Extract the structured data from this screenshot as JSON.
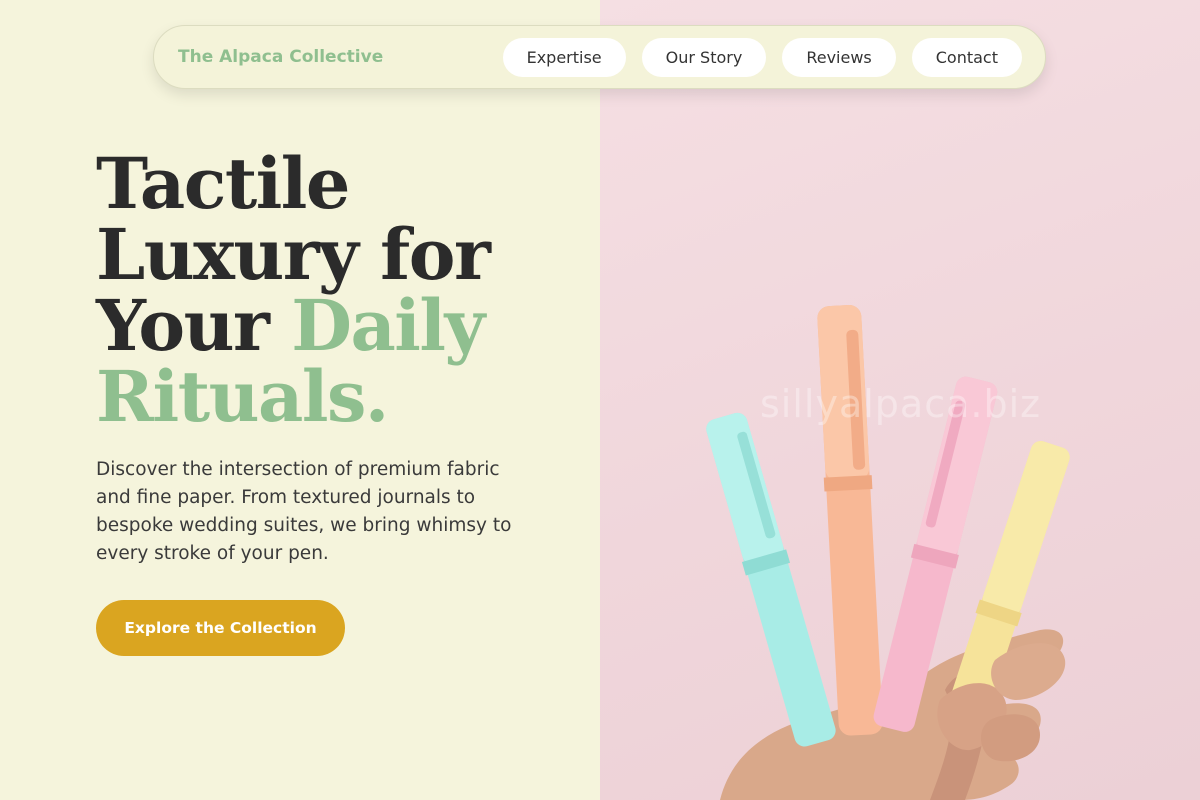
{
  "nav": {
    "brand": "The Alpaca Collective",
    "links": [
      {
        "label": "Expertise"
      },
      {
        "label": "Our Story"
      },
      {
        "label": "Reviews"
      },
      {
        "label": "Contact"
      }
    ]
  },
  "hero": {
    "headline_part1": "Tactile Luxury for Your ",
    "headline_accent": "Daily Rituals.",
    "description": "Discover the intersection of premium fabric and fine paper. From textured journals to bespoke wedding suites, we bring whimsy to every stroke of your pen.",
    "cta_label": "Explore the Collection"
  },
  "image": {
    "watermark": "sillyalpaca.biz",
    "subject": "hand holding pastel highlighter pens"
  },
  "colors": {
    "accent_green": "#8fbf8f",
    "cta_gold": "#daa520",
    "left_bg": "#f5f4dc",
    "right_bg": "#f0d6db",
    "heading_text": "#2b2b2b"
  }
}
